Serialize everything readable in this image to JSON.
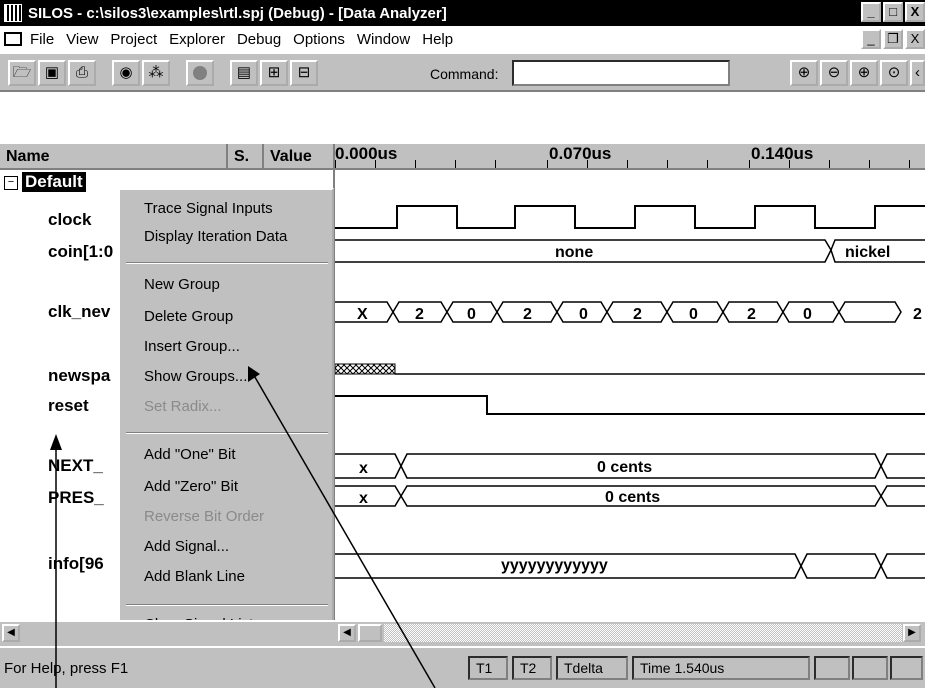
{
  "window": {
    "title": "SILOS - c:\\silos3\\examples\\rtl.spj (Debug) - [Data Analyzer]",
    "buttons": [
      "_",
      "□",
      "X"
    ]
  },
  "menu": {
    "items": [
      "File",
      "View",
      "Project",
      "Explorer",
      "Debug",
      "Options",
      "Window",
      "Help"
    ],
    "doc_buttons": [
      "_",
      "❐",
      "X"
    ]
  },
  "toolbar": {
    "command_label": "Command:",
    "command_value": ""
  },
  "header": {
    "name": "Name",
    "s": "S.",
    "value": "Value",
    "time_labels": [
      "0.000us",
      "0.070us",
      "0.140us"
    ]
  },
  "signals": [
    "Default",
    "clock",
    "coin[1:0",
    "clk_nev",
    "newspa",
    "reset",
    "NEXT_",
    "PRES_",
    "info[96"
  ],
  "context_menu": {
    "items": [
      "Trace Signal Inputs",
      "Display Iteration Data",
      "New Group",
      "Delete Group",
      "Insert Group...",
      "Show Groups...",
      "Set Radix...",
      "Add \"One\" Bit",
      "Add \"Zero\" Bit",
      "Reverse Bit Order",
      "Add Signal...",
      "Add Blank Line",
      "Clear Signal List"
    ]
  },
  "waveform": {
    "coin_values": [
      "none",
      "nickel"
    ],
    "clk_new_values": [
      "X",
      "2",
      "0",
      "2",
      "0",
      "2",
      "0",
      "2",
      "0",
      "2"
    ],
    "next_value": "0 cents",
    "pres_value": "0 cents",
    "next_x": "x",
    "pres_x": "x",
    "info_value": "yyyyyyyyyyyy"
  },
  "status": {
    "help": "For Help, press F1",
    "t1": "T1",
    "t2": "T2",
    "tdelta": "Tdelta",
    "time": "Time 1.540us"
  }
}
